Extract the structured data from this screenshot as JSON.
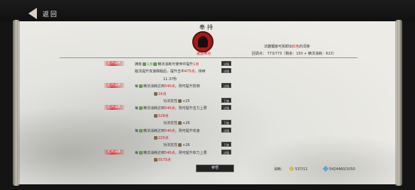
{
  "topbar": {
    "back_label": "返回"
  },
  "panel": {
    "title": "奉持",
    "seal_name": "逍遥神功",
    "info_line1_pre": "法器镶嵌可拆卸出",
    "info_line1_red": "红色",
    "info_line1_post": "的词条",
    "info_line2": "回调点：  773/773（剩余：150 + 精法消耗：623）"
  },
  "rows": [
    {
      "tag": "红色词条",
      "pre": "拥有",
      "grn": "1点",
      "mid": "精法消耗可使命中提升",
      "red": "1点",
      "post": "",
      "btn": "详情"
    },
    {
      "tag": "",
      "pre": "敌法提升攻速御敌后，提升击中",
      "grn": "",
      "mid": "",
      "red": "475点",
      "post": "，持续",
      "btn": "详情"
    },
    {
      "tag": "",
      "pre": "",
      "grn": "",
      "mid": "11.37秒",
      "red": "",
      "post": "",
      "btn": ""
    },
    {
      "tag": "红色词条",
      "pre": "每",
      "grn": "",
      "mid": "精法消耗达到",
      "red": "540点",
      "post": "，则可提升防御",
      "btn": "详情"
    },
    {
      "tag": "",
      "pre": "",
      "grn": "",
      "mid": "",
      "red": "",
      "post": "16点",
      "btn": ""
    },
    {
      "tag": "",
      "pre": "",
      "grn": "",
      "mid": "功法抗性",
      "red": "",
      "post": "+25",
      "btn": "下移"
    },
    {
      "tag": "红色词条",
      "pre": "每",
      "grn": "",
      "mid": "精法消耗达到",
      "red": "540点",
      "post": "，则可提升击力上限",
      "btn": "详情"
    },
    {
      "tag": "",
      "pre": "",
      "grn": "",
      "mid": "",
      "red": "",
      "post": "528点",
      "btn": ""
    },
    {
      "tag": "",
      "pre": "",
      "grn": "",
      "mid": "功法抗性",
      "red": "",
      "post": "+26",
      "btn": "下移"
    },
    {
      "tag": "",
      "pre": "每",
      "grn": "",
      "mid": "精法消耗达到",
      "red": "540点",
      "post": "，则可提升攻速",
      "btn": "详情"
    },
    {
      "tag": "",
      "pre": "",
      "grn": "",
      "mid": "",
      "red": "",
      "post": "225点",
      "btn": ""
    },
    {
      "tag": "",
      "pre": "",
      "grn": "",
      "mid": "功法抗性",
      "red": "",
      "post": "+26",
      "btn": "下移"
    },
    {
      "tag": "红色词条",
      "pre": "每",
      "grn": "",
      "mid": "精法消耗达到",
      "red": "540点",
      "post": "，则可提升体力上限",
      "btn": "详情"
    },
    {
      "tag": "",
      "pre": "",
      "grn": "",
      "mid": "",
      "red": "",
      "post": "5573点",
      "btn": ""
    }
  ],
  "footer": {
    "main_button": "参悟",
    "currency_label": "消耗：",
    "coin": "537/11",
    "gem": "5424460/1050"
  }
}
